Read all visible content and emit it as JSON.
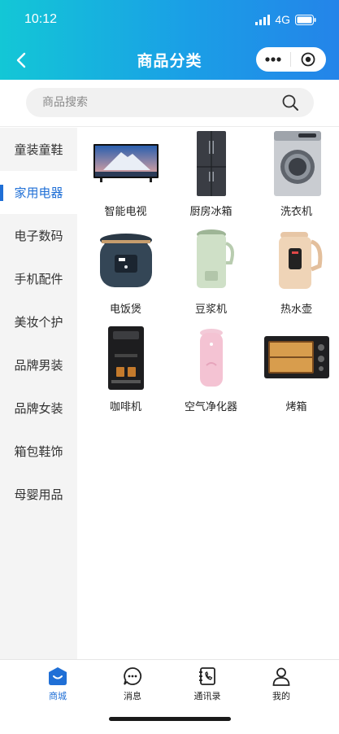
{
  "status_bar": {
    "time": "10:12",
    "network": "4G"
  },
  "nav": {
    "title": "商品分类",
    "back_icon": "chevron-left-icon",
    "more_icon": "more-dots-icon",
    "close_icon": "target-circle-icon"
  },
  "search": {
    "placeholder": "商品搜索",
    "value": ""
  },
  "sidebar": {
    "active_index": 1,
    "items": [
      {
        "label": "童装童鞋"
      },
      {
        "label": "家用电器"
      },
      {
        "label": "电子数码"
      },
      {
        "label": "手机配件"
      },
      {
        "label": "美妆个护"
      },
      {
        "label": "品牌男装"
      },
      {
        "label": "品牌女装"
      },
      {
        "label": "箱包鞋饰"
      },
      {
        "label": "母婴用品"
      }
    ]
  },
  "products": [
    {
      "label": "智能电视",
      "icon": "tv-image"
    },
    {
      "label": "厨房冰箱",
      "icon": "fridge-image"
    },
    {
      "label": "洗衣机",
      "icon": "washer-image"
    },
    {
      "label": "电饭煲",
      "icon": "rice-cooker-image"
    },
    {
      "label": "豆浆机",
      "icon": "soymilk-maker-image"
    },
    {
      "label": "热水壶",
      "icon": "kettle-image"
    },
    {
      "label": "咖啡机",
      "icon": "coffee-machine-image"
    },
    {
      "label": "空气净化器",
      "icon": "air-purifier-image"
    },
    {
      "label": "烤箱",
      "icon": "oven-image"
    }
  ],
  "tabbar": {
    "active_index": 0,
    "tabs": [
      {
        "label": "商城",
        "icon": "shop-icon"
      },
      {
        "label": "消息",
        "icon": "message-icon"
      },
      {
        "label": "通讯录",
        "icon": "contacts-icon"
      },
      {
        "label": "我的",
        "icon": "user-icon"
      }
    ]
  },
  "colors": {
    "accent": "#1f6fd6",
    "header_start": "#13c7d6",
    "header_end": "#2484e9",
    "sidebar_bg": "#f4f4f4"
  }
}
